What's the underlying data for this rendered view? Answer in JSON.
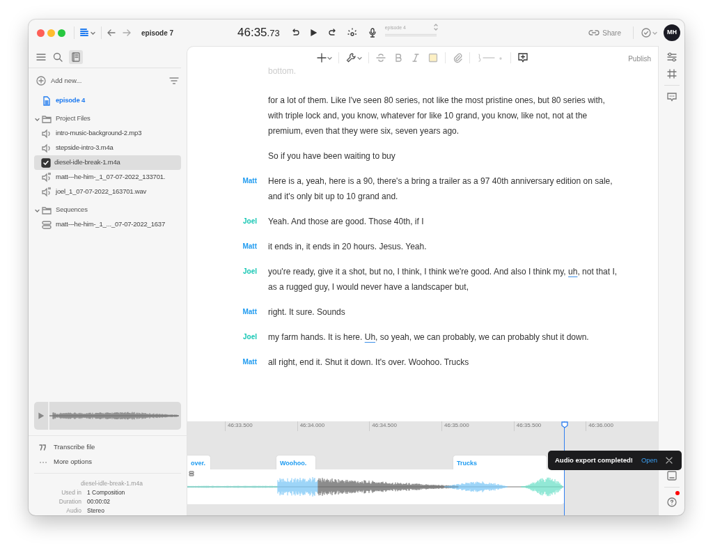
{
  "window": {
    "title": "episode 7"
  },
  "titlebar": {
    "timecode": "46:35",
    "timecode_fraction": ".73",
    "composition": "episode 4",
    "share": "Share",
    "avatar": "MH"
  },
  "sidebar": {
    "add_new": "Add new...",
    "tree": [
      {
        "kind": "document",
        "label": "episode 4",
        "selected": false,
        "open": true
      },
      {
        "kind": "folder",
        "label": "Project Files",
        "selected": false,
        "expanded": true,
        "children": [
          {
            "kind": "audio",
            "label": "intro-music-background-2.mp3",
            "selected": false
          },
          {
            "kind": "audio",
            "label": "stepside-intro-3.m4a",
            "selected": false
          },
          {
            "kind": "audio",
            "label": "diesel-idle-break-1.m4a",
            "selected": true
          },
          {
            "kind": "transcribed-audio",
            "label": "matt---he-him-_1_07-07-2022_133701.",
            "selected": false
          },
          {
            "kind": "transcribed-audio",
            "label": "joel_1_07-07-2022_163701.wav",
            "selected": false
          }
        ]
      },
      {
        "kind": "folder",
        "label": "Sequences",
        "selected": false,
        "expanded": true,
        "children": [
          {
            "kind": "sequence",
            "label": "matt---he-him-_1_..._07-07-2022_1637",
            "selected": false
          }
        ]
      }
    ],
    "actions": [
      {
        "kind": "transcribe",
        "label": "Transcribe file"
      },
      {
        "kind": "more",
        "label": "More options"
      }
    ],
    "info": {
      "filename": "diesel-idle-break-1.m4a",
      "rows": [
        {
          "label": "Used in",
          "value": "1 Composition"
        },
        {
          "label": "Duration",
          "value": "00:00:02"
        },
        {
          "label": "Audio",
          "value": "Stereo"
        }
      ]
    }
  },
  "editor": {
    "publish": "Publish",
    "faded_text": "bottom.",
    "transcript": [
      {
        "segments": [
          {
            "text": "for a lot of them. Like I've seen 80 series, not like the most pristine ones, but 80 series with, with triple lock and, you know, whatever for like 10 grand, you know, like not, not at the premium, even that they were six, seven years ago.",
            "filler": false
          }
        ]
      },
      {
        "segments": [
          {
            "text": "So if you have been waiting to buy",
            "filler": false
          }
        ]
      },
      {
        "speaker": "Matt",
        "color": "#1f9bf0",
        "segments": [
          {
            "text": "Here is a, yeah, here is a 90, there's a bring a trailer as a 97 40th anniversary edition on sale, and it's only bit up to 10 grand and.",
            "filler": false
          }
        ]
      },
      {
        "speaker": "Joel",
        "color": "#13c6b3",
        "segments": [
          {
            "text": "Yeah. And those are good. Those 40th, if I",
            "filler": false
          }
        ]
      },
      {
        "speaker": "Matt",
        "color": "#1f9bf0",
        "segments": [
          {
            "text": "it ends in, it ends in 20 hours. Jesus. Yeah.",
            "filler": false
          }
        ]
      },
      {
        "speaker": "Joel",
        "color": "#13c6b3",
        "segments": [
          {
            "text": "you're ready, give it a shot, but no, I think, I think we're good. And also I think my, ",
            "filler": false
          },
          {
            "text": "uh",
            "filler": true
          },
          {
            "text": ", not that I, as a rugged guy, I would never have a landscaper  but,",
            "filler": false
          }
        ]
      },
      {
        "speaker": "Matt",
        "color": "#1f9bf0",
        "segments": [
          {
            "text": "right. It sure. Sounds",
            "filler": false
          }
        ]
      },
      {
        "speaker": "Joel",
        "color": "#13c6b3",
        "segments": [
          {
            "text": "my farm hands. It is here. ",
            "filler": false
          },
          {
            "text": "Uh",
            "filler": true
          },
          {
            "text": ", so yeah, we can probably, we can probably shut it down.",
            "filler": false
          }
        ]
      },
      {
        "speaker": "Matt",
        "color": "#1f9bf0",
        "segments": [
          {
            "text": "all right, end it. Shut it down. It's over. Woohoo. Trucks",
            "filler": false
          }
        ]
      }
    ]
  },
  "timeline": {
    "ticks": [
      "46:33.500",
      "46:34.000",
      "46:34.500",
      "46:35.000",
      "46:35.500",
      "46:36.000"
    ],
    "clips": [
      {
        "label": "over."
      },
      {
        "label": "Woohoo."
      },
      {
        "label": "Trucks"
      }
    ]
  },
  "toast": {
    "message": "Audio export completed!",
    "action": "Open"
  },
  "right_rail": {
    "help_unread": true
  }
}
